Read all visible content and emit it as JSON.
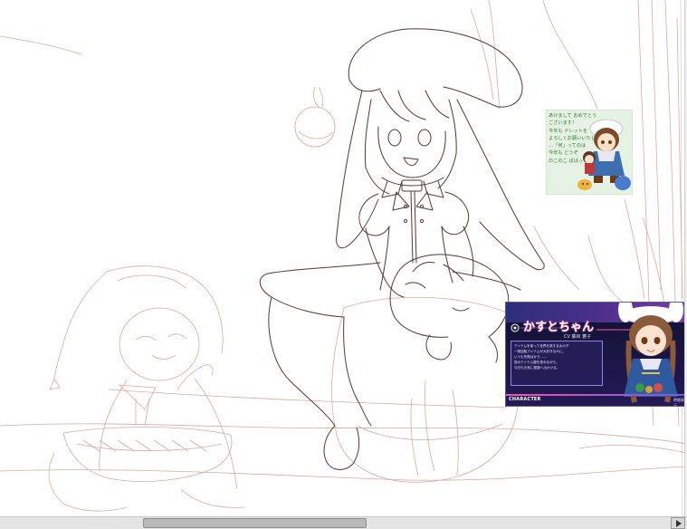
{
  "canvas": {
    "background": "#ffffff",
    "sketch_color": "#c98a80",
    "lineart_color": "#5a3535"
  },
  "reference_card": {
    "message_lines": [
      "あけまして おめでとう",
      "ございます！",
      "今年も ナレットを",
      "よろしくお願いいたします。",
      "…「何」ってのは",
      "今年も どうぞ",
      "のこのこ ぱぱっ"
    ],
    "background": "#e6f2e3",
    "text_color": "#2f7d32"
  },
  "reference_profile": {
    "character_name": "かすとちゃん",
    "voice_credit": "CV 藤目 蒼子",
    "description_lines": [
      "アイテムを使って世界を旅する女の子",
      "一発逆転アイテムが大好きなのに、",
      "いつも失敗ばかり……",
      "旅のアイテム屋を営みながら、",
      "今日も元気に冒険へ出かける。"
    ],
    "footer_label": "CHARACTER",
    "corner_text": "時間表示",
    "accent_pink": "#ff4fb0",
    "accent_blue": "#6a5fd8"
  },
  "scrollbar": {
    "right_arrow": "arrow-right-icon"
  }
}
